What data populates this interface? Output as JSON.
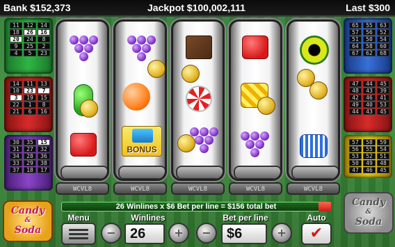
{
  "header": {
    "bank": "Bank $152,373",
    "jackpot": "Jackpot $100,002,111",
    "last": "Last $300"
  },
  "left_lines": {
    "green": [
      "11",
      "12",
      "14",
      "18",
      "26",
      "16",
      "20",
      "24",
      "8",
      "9",
      "25",
      "2",
      "4",
      "5",
      "23"
    ],
    "red": [
      "14",
      "11",
      "13",
      "10",
      "23",
      "7",
      "3",
      "19",
      "15",
      "22",
      "1",
      "8",
      "21",
      "6",
      "16"
    ],
    "purple": [
      "30",
      "35",
      "15",
      "31",
      "27",
      "32",
      "34",
      "28",
      "36",
      "33",
      "29",
      "38",
      "37",
      "18",
      "17"
    ]
  },
  "right_lines": {
    "blue": [
      "65",
      "55",
      "63",
      "57",
      "56",
      "52",
      "51",
      "50",
      "54",
      "64",
      "58",
      "60",
      "67",
      "62",
      "68"
    ],
    "red": [
      "47",
      "44",
      "45",
      "48",
      "43",
      "39",
      "42",
      "46",
      "41",
      "49",
      "40",
      "53",
      "44",
      "43",
      "45"
    ],
    "yellow": [
      "57",
      "58",
      "59",
      "56",
      "55",
      "54",
      "53",
      "52",
      "51",
      "50",
      "49",
      "48",
      "47",
      "46",
      "45"
    ]
  },
  "logos": {
    "left": [
      "Candy",
      "&",
      "Soda"
    ],
    "right": [
      "Candy",
      "&",
      "Soda"
    ]
  },
  "reel_labels": [
    "WCVL8",
    "WCVL8",
    "WCVL8",
    "WCVL8",
    "WCVL8"
  ],
  "bonus_label": "BONUS",
  "bet_summary": "26 Winlines x $6 Bet per line = $156 total bet",
  "controls": {
    "menu_label": "Menu",
    "winlines_label": "Winlines",
    "winlines_value": "26",
    "bet_label": "Bet per line",
    "bet_value": "$6",
    "auto_label": "Auto",
    "minus": "−",
    "plus": "+",
    "auto_check": "✔"
  },
  "colors": {
    "bg_green": "#3a8f3b",
    "accent_red": "#d81818",
    "coin_gold": "#e0b020"
  }
}
